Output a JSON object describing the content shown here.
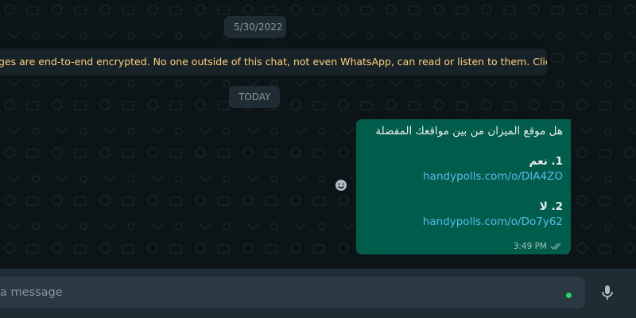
{
  "chat": {
    "date_label": "5/30/2022",
    "encryption_notice": "ges are end-to-end encrypted. No one outside of this chat, not even WhatsApp, can read or listen to them. Click to learn more.",
    "today_label": "TODAY",
    "message": {
      "question": "هل موقع الميزان من بين مواقعك المفضلة",
      "option1_label": "1. نعم",
      "option1_link": "handypolls.com/o/DIA4ZO",
      "option2_label": "2. لا",
      "option2_link": "handypolls.com/o/Do7y62",
      "time": "3:49 PM",
      "status": "read"
    },
    "reaction_icon": "smiley-icon"
  },
  "composer": {
    "placeholder": "a message",
    "mic_icon": "microphone-icon"
  },
  "colors": {
    "bubble_outgoing": "#005c4b",
    "link": "#53bdeb",
    "encryption_text": "#ffd279",
    "read_ticks": "#8fa7b0"
  }
}
